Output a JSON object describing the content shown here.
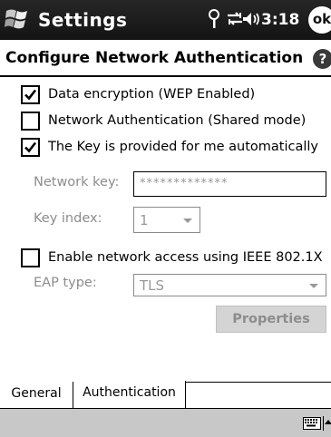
{
  "titlebar": {
    "app_title": "Settings",
    "clock": "3:18",
    "ok_label": "ok",
    "icons": [
      "start-menu-logo",
      "antenna-icon",
      "connectivity-icon",
      "speaker-icon"
    ]
  },
  "header": {
    "title": "Configure Network Authentication",
    "help_label": "?"
  },
  "options": {
    "data_encryption": {
      "label": "Data encryption (WEP Enabled)",
      "checked": true
    },
    "network_auth": {
      "label": "Network Authentication (Shared mode)",
      "checked": false
    },
    "key_auto": {
      "label": "The Key is provided for me automatically",
      "checked": true
    },
    "ieee8021x": {
      "label": "Enable network access using IEEE 802.1X",
      "checked": false
    }
  },
  "fields": {
    "network_key_label": "Network key:",
    "network_key_value": "*************",
    "key_index_label": "Key index:",
    "key_index_value": "1",
    "eap_type_label": "EAP type:",
    "eap_type_value": "TLS"
  },
  "buttons": {
    "properties": "Properties"
  },
  "tabs": [
    {
      "label": "General",
      "active": false
    },
    {
      "label": "Authentication",
      "active": true
    }
  ],
  "colors": {
    "titlebar": "#1c1c1c",
    "disabled_text": "#8c8c8c",
    "bottombar": "#c8c8c8"
  }
}
